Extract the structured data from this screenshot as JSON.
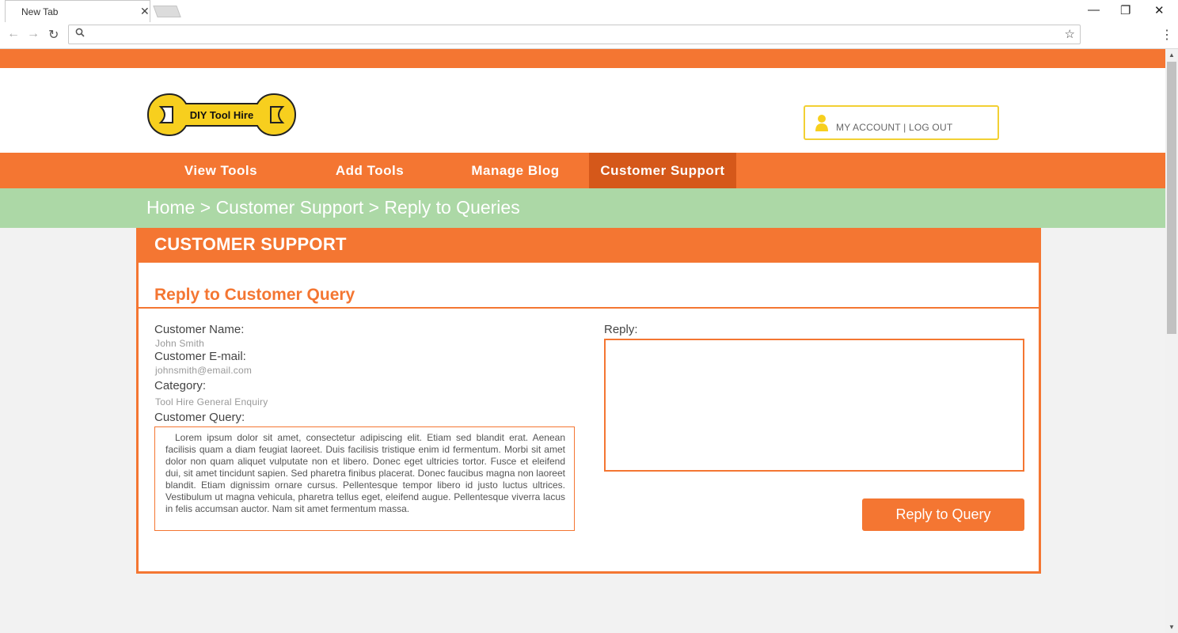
{
  "browser": {
    "tab_title": "New Tab",
    "tab_close": "✕",
    "window_minimize": "—",
    "window_restore": "❐",
    "window_close": "✕",
    "back": "←",
    "forward": "→",
    "reload": "↻",
    "address_value": "",
    "star": "☆",
    "menu": "⋮"
  },
  "site": {
    "logo_text": "DIY Tool Hire",
    "account_label": "MY ACCOUNT | LOG OUT",
    "accent_color": "#f47632",
    "active_nav_color": "#d5581a",
    "breadcrumb_color": "#acd8a6",
    "logo_color": "#f7cf1e"
  },
  "nav": {
    "items": [
      {
        "label": "View Tools"
      },
      {
        "label": "Add Tools"
      },
      {
        "label": "Manage Blog"
      },
      {
        "label": "Customer Support"
      }
    ],
    "active": "Customer Support"
  },
  "breadcrumb": {
    "text": "Home > Customer Support > Reply to Queries"
  },
  "panel": {
    "title": "CUSTOMER SUPPORT",
    "section_title": "Reply to Customer Query",
    "customer_name_label": "Customer Name:",
    "customer_name": "John Smith",
    "customer_email_label": "Customer E-mail:",
    "customer_email": "johnsmith@email.com",
    "category_label": "Category:",
    "category": "Tool Hire General Enquiry",
    "query_label": "Customer Query:",
    "query_text": "Lorem ipsum dolor sit amet, consectetur adipiscing elit. Etiam sed blandit erat. Aenean facilisis quam a diam feugiat laoreet. Duis facilisis tristique enim id fermentum. Morbi sit amet dolor non quam aliquet vulputate non et libero. Donec eget ultricies tortor. Fusce et eleifend dui, sit amet tincidunt sapien. Sed pharetra finibus placerat. Donec faucibus magna non laoreet blandit. Etiam dignissim ornare cursus. Pellentesque tempor libero id justo luctus ultrices. Vestibulum ut magna vehicula, pharetra tellus eget, eleifend augue. Pellentesque viverra lacus in felis accumsan auctor. Nam sit amet fermentum massa.",
    "reply_label": "Reply:",
    "reply_value": "",
    "reply_button": "Reply to Query"
  }
}
